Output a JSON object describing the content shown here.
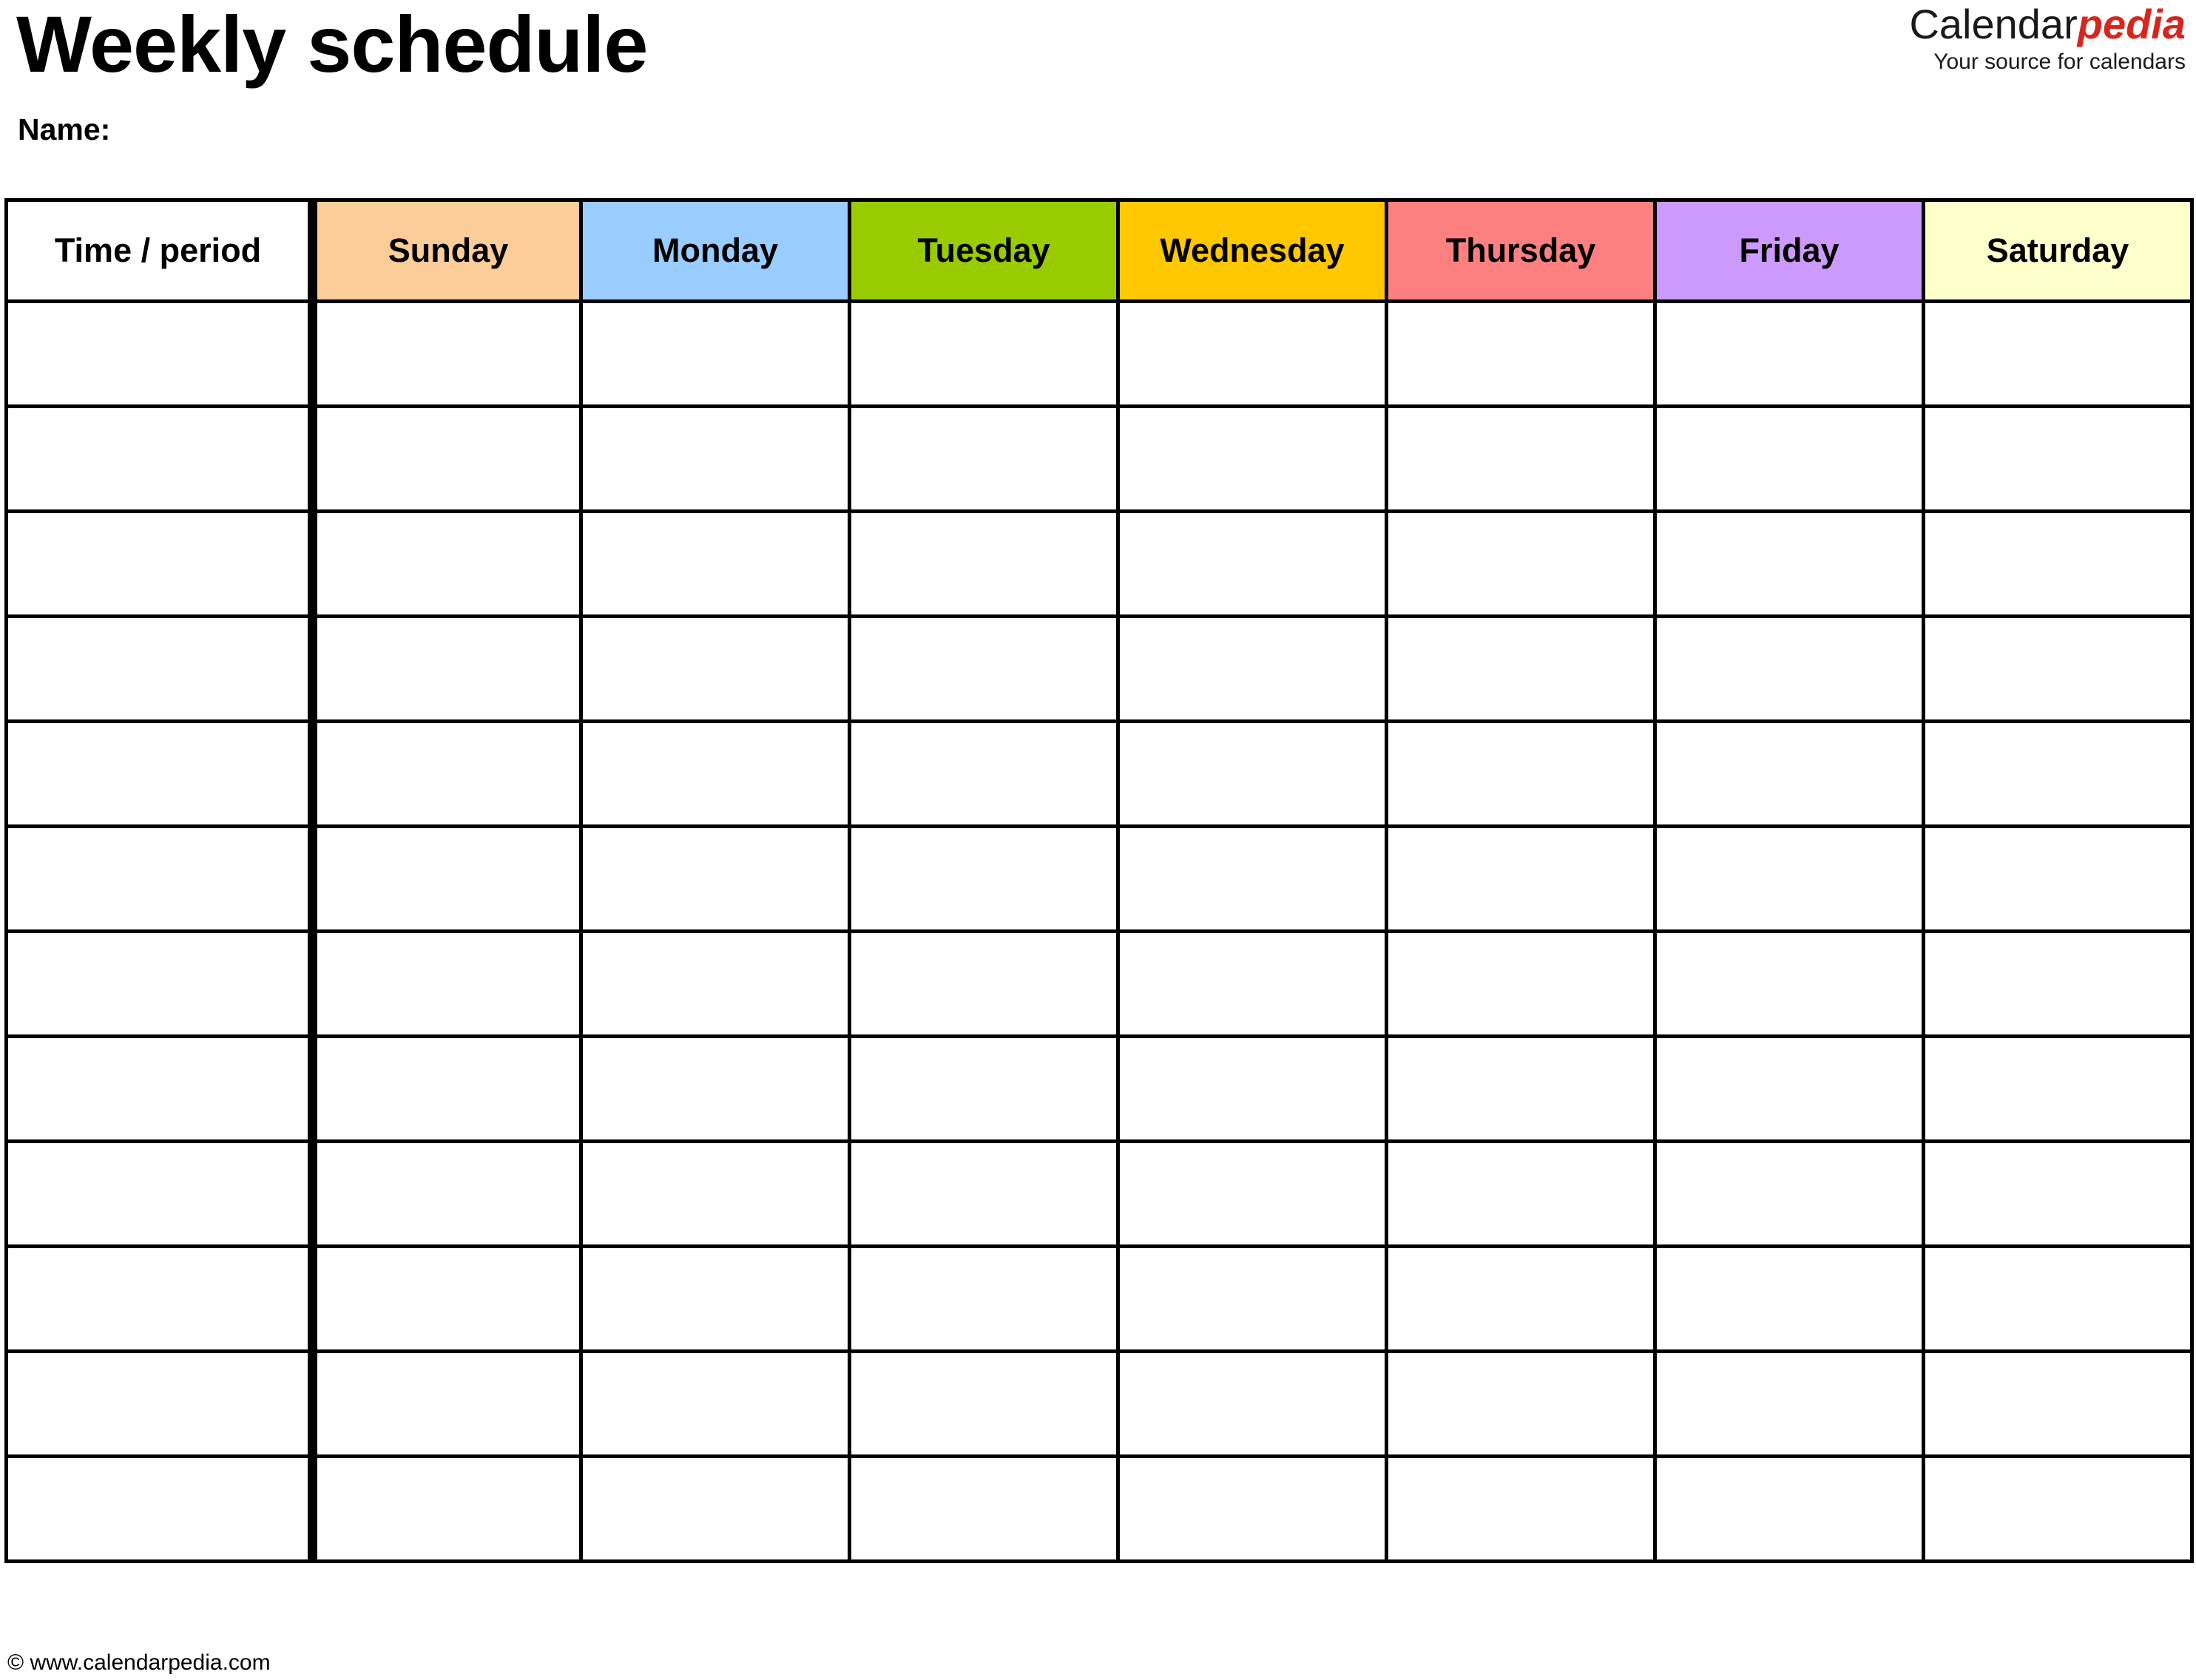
{
  "document": {
    "title": "Weekly schedule",
    "name_label": "Name:"
  },
  "logo": {
    "brand_first": "Calendar",
    "brand_second": "pedia",
    "tagline": "Your source for calendars",
    "accent_color": "#d7261e",
    "text_color": "#1a1a1a"
  },
  "table": {
    "columns": [
      {
        "label": "Time / period",
        "color": "#ffffff"
      },
      {
        "label": "Sunday",
        "color": "#fccc99"
      },
      {
        "label": "Monday",
        "color": "#99ccff"
      },
      {
        "label": "Tuesday",
        "color": "#99cc00"
      },
      {
        "label": "Wednesday",
        "color": "#ffc800"
      },
      {
        "label": "Thursday",
        "color": "#fc8080"
      },
      {
        "label": "Friday",
        "color": "#cc99fc"
      },
      {
        "label": "Saturday",
        "color": "#ffffcc"
      }
    ],
    "row_count": 12,
    "rows": [
      [
        "",
        "",
        "",
        "",
        "",
        "",
        "",
        ""
      ],
      [
        "",
        "",
        "",
        "",
        "",
        "",
        "",
        ""
      ],
      [
        "",
        "",
        "",
        "",
        "",
        "",
        "",
        ""
      ],
      [
        "",
        "",
        "",
        "",
        "",
        "",
        "",
        ""
      ],
      [
        "",
        "",
        "",
        "",
        "",
        "",
        "",
        ""
      ],
      [
        "",
        "",
        "",
        "",
        "",
        "",
        "",
        ""
      ],
      [
        "",
        "",
        "",
        "",
        "",
        "",
        "",
        ""
      ],
      [
        "",
        "",
        "",
        "",
        "",
        "",
        "",
        ""
      ],
      [
        "",
        "",
        "",
        "",
        "",
        "",
        "",
        ""
      ],
      [
        "",
        "",
        "",
        "",
        "",
        "",
        "",
        ""
      ],
      [
        "",
        "",
        "",
        "",
        "",
        "",
        "",
        ""
      ],
      [
        "",
        "",
        "",
        "",
        "",
        "",
        "",
        ""
      ]
    ]
  },
  "footer": {
    "copyright": "© www.calendarpedia.com"
  }
}
